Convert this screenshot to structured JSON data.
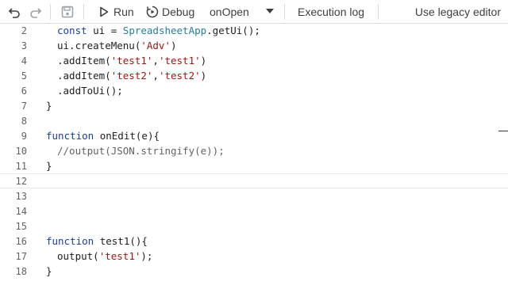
{
  "toolbar": {
    "run_label": "Run",
    "debug_label": "Debug",
    "function_selected": "onOpen",
    "execution_log_label": "Execution log",
    "legacy_label": "Use legacy editor",
    "icons": [
      "undo-icon",
      "redo-icon",
      "save-icon",
      "play-icon",
      "debug-icon",
      "dropdown-arrow-icon"
    ]
  },
  "editor": {
    "lines": [
      {
        "n": "2",
        "indent": 1,
        "parts": [
          {
            "t": "const ",
            "c": "kw"
          },
          {
            "t": "ui = ",
            "c": ""
          },
          {
            "t": "SpreadsheetApp",
            "c": "cls"
          },
          {
            "t": ".getUi();",
            "c": ""
          }
        ]
      },
      {
        "n": "3",
        "indent": 1,
        "parts": [
          {
            "t": "ui.createMenu(",
            "c": ""
          },
          {
            "t": "'Adv'",
            "c": "str"
          },
          {
            "t": ")",
            "c": ""
          }
        ]
      },
      {
        "n": "4",
        "indent": 1,
        "parts": [
          {
            "t": ".addItem(",
            "c": ""
          },
          {
            "t": "'test1'",
            "c": "str"
          },
          {
            "t": ",",
            "c": ""
          },
          {
            "t": "'test1'",
            "c": "str"
          },
          {
            "t": ")",
            "c": ""
          }
        ]
      },
      {
        "n": "5",
        "indent": 1,
        "parts": [
          {
            "t": ".addItem(",
            "c": ""
          },
          {
            "t": "'test2'",
            "c": "str"
          },
          {
            "t": ",",
            "c": ""
          },
          {
            "t": "'test2'",
            "c": "str"
          },
          {
            "t": ")",
            "c": ""
          }
        ]
      },
      {
        "n": "6",
        "indent": 1,
        "parts": [
          {
            "t": ".addToUi();",
            "c": ""
          }
        ]
      },
      {
        "n": "7",
        "indent": 0,
        "parts": [
          {
            "t": "}",
            "c": ""
          }
        ]
      },
      {
        "n": "8",
        "indent": 0,
        "parts": []
      },
      {
        "n": "9",
        "indent": 0,
        "parts": [
          {
            "t": "function ",
            "c": "kw"
          },
          {
            "t": "onEdit(e){",
            "c": ""
          }
        ]
      },
      {
        "n": "10",
        "indent": 1,
        "parts": [
          {
            "t": "//output(JSON.stringify(e));",
            "c": "cm"
          }
        ]
      },
      {
        "n": "11",
        "indent": 0,
        "parts": [
          {
            "t": "}",
            "c": ""
          }
        ]
      },
      {
        "n": "12",
        "indent": 0,
        "current": true,
        "parts": []
      },
      {
        "n": "13",
        "indent": 0,
        "parts": []
      },
      {
        "n": "14",
        "indent": 0,
        "parts": []
      },
      {
        "n": "15",
        "indent": 0,
        "parts": []
      },
      {
        "n": "16",
        "indent": 0,
        "parts": [
          {
            "t": "function ",
            "c": "kw"
          },
          {
            "t": "test1(){",
            "c": ""
          }
        ]
      },
      {
        "n": "17",
        "indent": 1,
        "parts": [
          {
            "t": "output(",
            "c": ""
          },
          {
            "t": "'test1'",
            "c": "str"
          },
          {
            "t": ");",
            "c": ""
          }
        ]
      },
      {
        "n": "18",
        "indent": 0,
        "parts": [
          {
            "t": "}",
            "c": ""
          }
        ]
      }
    ]
  }
}
